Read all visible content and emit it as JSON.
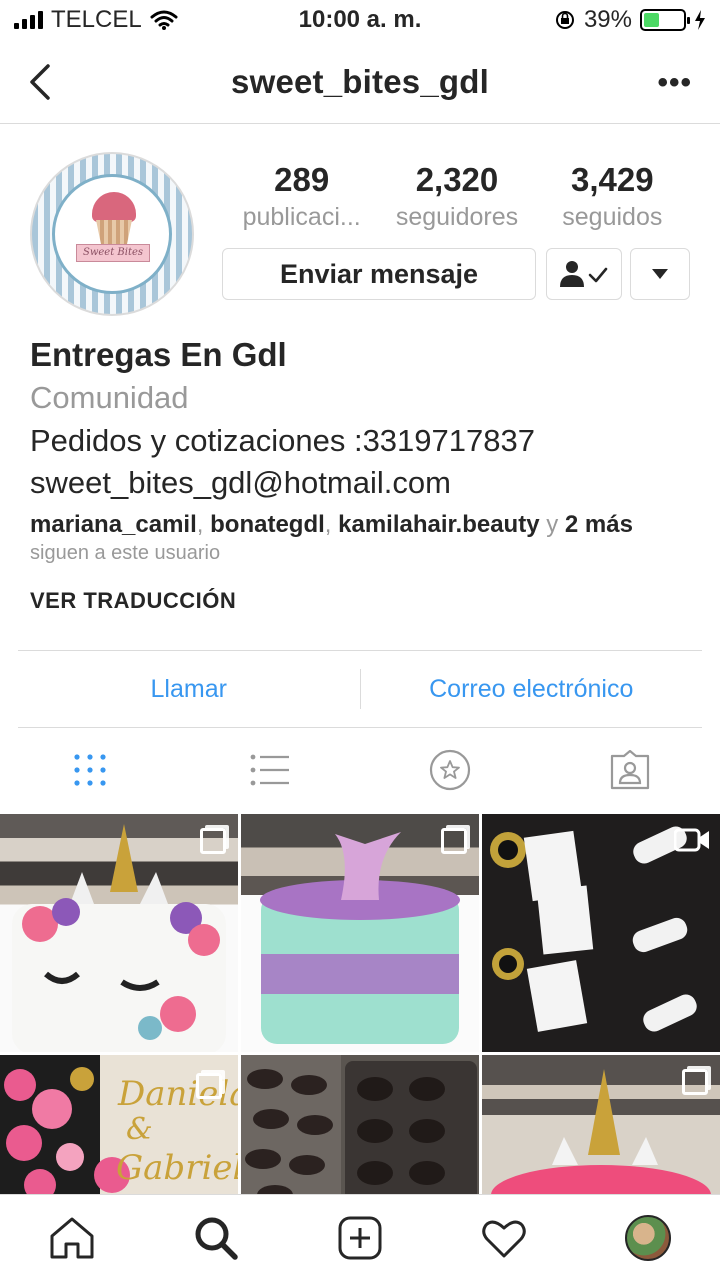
{
  "status_bar": {
    "carrier": "TELCEL",
    "time": "10:00 a. m.",
    "battery_percent": "39%",
    "battery_level": 0.39
  },
  "header": {
    "username": "sweet_bites_gdl"
  },
  "profile": {
    "avatar_text": "Sweet Bites",
    "stats": [
      {
        "value": "289",
        "label": "publicaci..."
      },
      {
        "value": "2,320",
        "label": "seguidores"
      },
      {
        "value": "3,429",
        "label": "seguidos"
      }
    ],
    "message_button": "Enviar mensaje"
  },
  "bio": {
    "name": "Entregas En Gdl",
    "category": "Comunidad",
    "line1": "Pedidos y cotizaciones :3319717837",
    "line2": "sweet_bites_gdl@hotmail.com",
    "followed_by": [
      "mariana_camil",
      "bonategdl",
      "kamilahair.beauty"
    ],
    "followed_more_prefix": "y",
    "followed_more": "2 más",
    "followed_sub": "siguen a este usuario",
    "translate": "VER TRADUCCIÓN"
  },
  "contact": {
    "call": "Llamar",
    "email": "Correo electrónico"
  },
  "tabs": [
    "grid-icon",
    "list-icon",
    "star-icon",
    "tagged-icon"
  ],
  "grid": {
    "tiles": [
      {
        "type": "carousel",
        "subject": "unicorn cake"
      },
      {
        "type": "carousel",
        "subject": "mermaid tail cake"
      },
      {
        "type": "video",
        "subject": "graduation cupcakes"
      },
      {
        "type": "image",
        "subject": "Daniela & Gabriel"
      },
      {
        "type": "image",
        "subject": "chocolate treats"
      },
      {
        "type": "carousel",
        "subject": "unicorn cake"
      }
    ],
    "tile4_text_1": "Daniela",
    "tile4_text_2": "&",
    "tile4_text_3": "Gabriel"
  },
  "colors": {
    "link_blue": "#3897f0",
    "muted_gray": "#999999",
    "border": "#dbdbdb",
    "battery_green": "#4cd964"
  },
  "bottom_nav": [
    "home-icon",
    "search-icon",
    "new-post-icon",
    "activity-icon",
    "profile-icon"
  ]
}
